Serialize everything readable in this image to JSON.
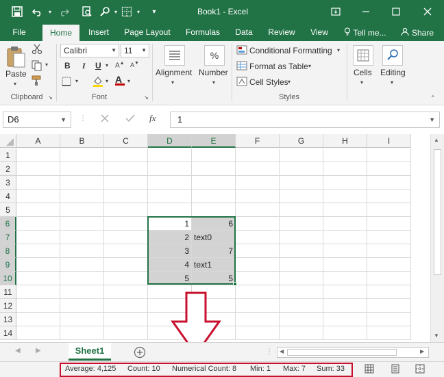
{
  "window": {
    "title": "Book1 - Excel"
  },
  "tabs": [
    "File",
    "Home",
    "Insert",
    "Page Layout",
    "Formulas",
    "Data",
    "Review",
    "View",
    "Tell me...",
    "Share"
  ],
  "ribbon": {
    "clipboard": {
      "paste_label": "Paste",
      "group_label": "Clipboard"
    },
    "font": {
      "font_name": "Calibri",
      "font_size": "11",
      "bold": "B",
      "italic": "I",
      "underline": "U",
      "font_color_glyph": "A",
      "group_label": "Font"
    },
    "alignment": {
      "label": "Alignment"
    },
    "number": {
      "label": "Number",
      "glyph": "%"
    },
    "styles": {
      "conditional_formatting": "Conditional Formatting",
      "format_as_table": "Format as Table",
      "cell_styles": "Cell Styles",
      "group_label": "Styles"
    },
    "cells": {
      "label": "Cells"
    },
    "editing": {
      "label": "Editing"
    }
  },
  "formula_bar": {
    "name_box": "D6",
    "fx": "fx",
    "value": "1"
  },
  "grid": {
    "columns": [
      "A",
      "B",
      "C",
      "D",
      "E",
      "F",
      "G",
      "H",
      "I"
    ],
    "rows": [
      "1",
      "2",
      "3",
      "4",
      "5",
      "6",
      "7",
      "8",
      "9",
      "10",
      "11",
      "12",
      "13",
      "14"
    ],
    "cells": {
      "D6": "1",
      "E6": "6",
      "D7": "2",
      "E7": "text0",
      "D8": "3",
      "E8": "7",
      "D9": "4",
      "E9": "text1",
      "D10": "5",
      "E10": "5"
    }
  },
  "sheet": {
    "tab_label": "Sheet1"
  },
  "status": {
    "average": "Average: 4,125",
    "count": "Count: 10",
    "numerical_count": "Numerical Count: 8",
    "min": "Min: 1",
    "max": "Max: 7",
    "sum": "Sum: 33"
  },
  "colors": {
    "brand": "#217346",
    "annotation": "#c8102e"
  }
}
